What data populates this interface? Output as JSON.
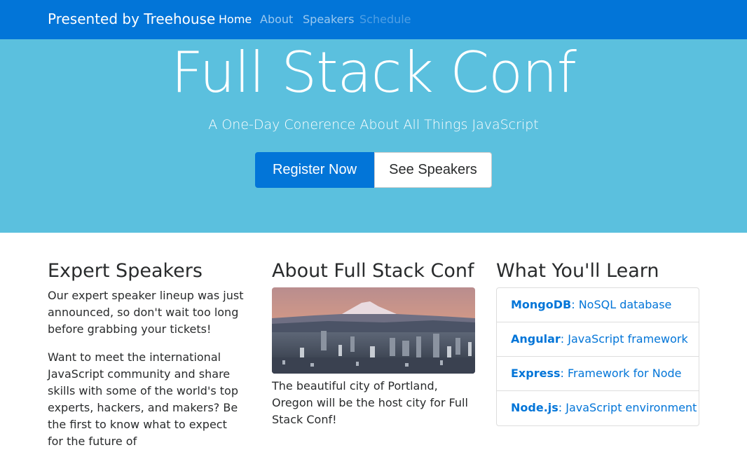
{
  "navbar": {
    "brand": "Presented by Treehouse",
    "links": [
      {
        "label": "Home",
        "state": "active"
      },
      {
        "label": "About",
        "state": "normal"
      },
      {
        "label": "Speakers",
        "state": "normal"
      },
      {
        "label": "Schedule",
        "state": "disabled"
      }
    ]
  },
  "hero": {
    "title": "Full Stack Conf",
    "subtitle": "A One-Day Conerence About All Things JavaScript",
    "register_label": "Register Now",
    "speakers_label": "See Speakers"
  },
  "speakers_section": {
    "title": "Expert Speakers",
    "paragraphs": [
      "Our expert speaker lineup was just announced, so don't wait too long before grabbing your tickets!",
      "Want to meet the international JavaScript community and share skills with some of the world's top experts, hackers, and makers? Be the first to know what to expect for the future of"
    ]
  },
  "about_section": {
    "title": "About Full Stack Conf",
    "caption": "The beautiful city of Portland, Oregon will be the host city for Full Stack Conf!"
  },
  "learn_section": {
    "title": "What You'll Learn",
    "items": [
      {
        "name": "MongoDB",
        "desc": ": NoSQL database"
      },
      {
        "name": "Angular",
        "desc": ": JavaScript framework"
      },
      {
        "name": "Express",
        "desc": ": Framework for Node"
      },
      {
        "name": "Node.js",
        "desc": ": JavaScript environment"
      }
    ]
  },
  "colors": {
    "primary": "#0275d8",
    "hero_bg": "#5bc0de",
    "text": "#292b2c"
  }
}
